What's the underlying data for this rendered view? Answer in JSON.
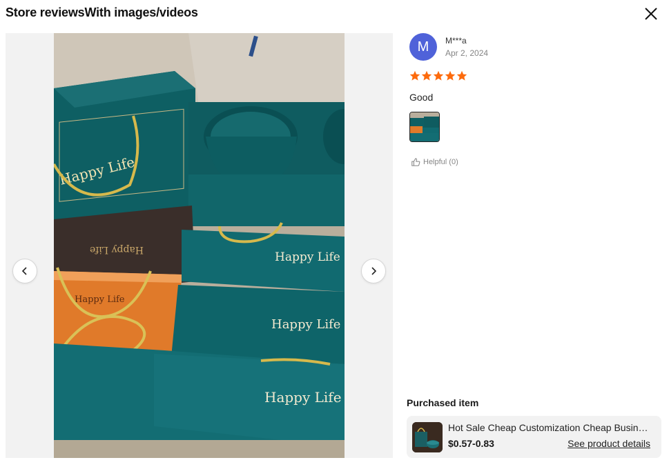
{
  "header": {
    "title": "Store reviewsWith images/videos",
    "close_icon": "close-icon"
  },
  "media": {
    "prev_icon": "chevron-left-icon",
    "next_icon": "chevron-right-icon",
    "box_text": "Happy Life"
  },
  "review": {
    "avatar_letter": "M",
    "reviewer_name": "M***a",
    "date": "Apr 2, 2024",
    "rating": 5,
    "text": "Good",
    "helpful_label": "Helpful (0)",
    "star_color": "#fd6b0d",
    "avatar_color": "#4f62d9"
  },
  "purchased": {
    "label": "Purchased item",
    "product_title": "Hot Sale Cheap Customization Cheap Business Gift Ceramic Mug Set",
    "price": "$0.57-0.83",
    "link_label": "See product details"
  }
}
